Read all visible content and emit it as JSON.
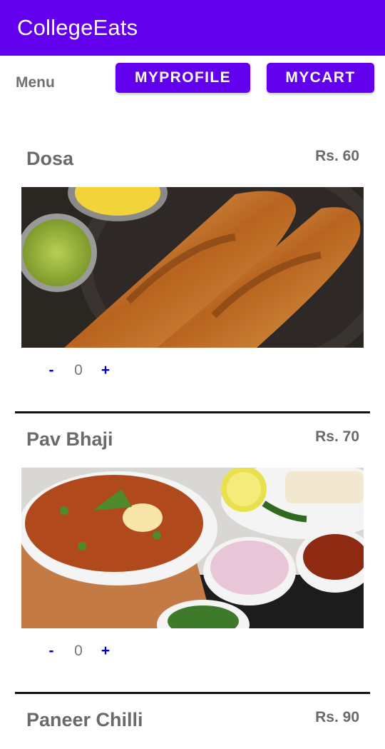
{
  "app": {
    "title": "CollegeEats"
  },
  "topbar": {
    "menu_label": "Menu",
    "profile_button": "MYPROFILE",
    "cart_button": "MYCART"
  },
  "items": [
    {
      "name": "Dosa",
      "price": "Rs. 60",
      "image": "dosa-photo",
      "qty": "0",
      "minus": "-",
      "plus": "+"
    },
    {
      "name": "Pav Bhaji",
      "price": "Rs. 70",
      "image": "pav-bhaji-photo",
      "qty": "0",
      "minus": "-",
      "plus": "+"
    },
    {
      "name": "Paneer Chilli",
      "price": "Rs. 90"
    }
  ],
  "colors": {
    "primary": "#6200EE",
    "qty_accent": "#0000cc",
    "divider": "#111111"
  }
}
